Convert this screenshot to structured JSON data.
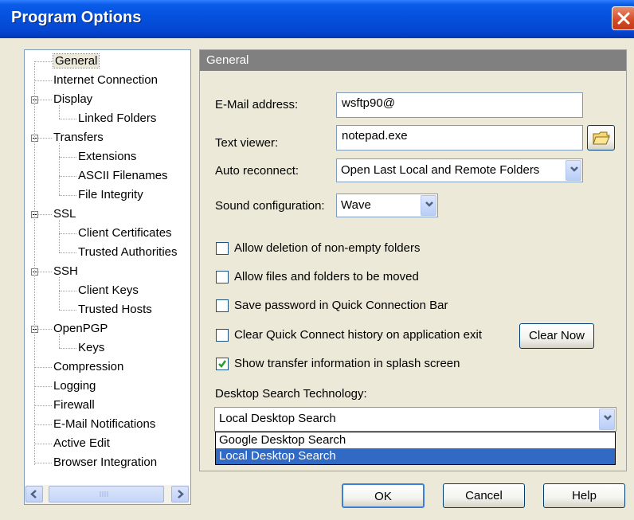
{
  "window": {
    "title": "Program Options"
  },
  "tree": {
    "items": [
      {
        "label": "General",
        "depth": 0,
        "expander": false,
        "selected": true
      },
      {
        "label": "Internet Connection",
        "depth": 0,
        "expander": false
      },
      {
        "label": "Display",
        "depth": 0,
        "expander": true
      },
      {
        "label": "Linked Folders",
        "depth": 1,
        "expander": false
      },
      {
        "label": "Transfers",
        "depth": 0,
        "expander": true
      },
      {
        "label": "Extensions",
        "depth": 1,
        "expander": false
      },
      {
        "label": "ASCII Filenames",
        "depth": 1,
        "expander": false
      },
      {
        "label": "File Integrity",
        "depth": 1,
        "expander": false
      },
      {
        "label": "SSL",
        "depth": 0,
        "expander": true
      },
      {
        "label": "Client Certificates",
        "depth": 1,
        "expander": false
      },
      {
        "label": "Trusted Authorities",
        "depth": 1,
        "expander": false
      },
      {
        "label": "SSH",
        "depth": 0,
        "expander": true
      },
      {
        "label": "Client Keys",
        "depth": 1,
        "expander": false
      },
      {
        "label": "Trusted Hosts",
        "depth": 1,
        "expander": false
      },
      {
        "label": "OpenPGP",
        "depth": 0,
        "expander": true
      },
      {
        "label": "Keys",
        "depth": 1,
        "expander": false
      },
      {
        "label": "Compression",
        "depth": 0,
        "expander": false
      },
      {
        "label": "Logging",
        "depth": 0,
        "expander": false
      },
      {
        "label": "Firewall",
        "depth": 0,
        "expander": false
      },
      {
        "label": "E-Mail Notifications",
        "depth": 0,
        "expander": false
      },
      {
        "label": "Active Edit",
        "depth": 0,
        "expander": false
      },
      {
        "label": "Browser Integration",
        "depth": 0,
        "expander": false
      }
    ]
  },
  "panel": {
    "header": "General",
    "email": {
      "label": "E-Mail address:",
      "value": "wsftp90@"
    },
    "viewer": {
      "label": "Text viewer:",
      "value": "notepad.exe"
    },
    "reconnect": {
      "label": "Auto reconnect:",
      "value": "Open Last Local and Remote Folders"
    },
    "sound": {
      "label": "Sound configuration:",
      "value": "Wave"
    },
    "checks": {
      "allow_delete": {
        "label": "Allow deletion of non-empty folders",
        "checked": false
      },
      "allow_move": {
        "label": "Allow files and folders to be moved",
        "checked": false
      },
      "save_password": {
        "label": "Save password in Quick Connection Bar",
        "checked": false
      },
      "clear_history": {
        "label": "Clear Quick Connect history on application exit",
        "checked": false
      },
      "show_transfer": {
        "label": "Show transfer information in splash screen",
        "checked": true
      }
    },
    "clear_now": "Clear Now",
    "desktop_search": {
      "label": "Desktop Search Technology:",
      "value": "Local Desktop Search",
      "options": [
        "Google Desktop Search",
        "Local Desktop Search"
      ],
      "highlighted": "Local Desktop Search"
    }
  },
  "buttons": {
    "ok": "OK",
    "cancel": "Cancel",
    "help": "Help"
  }
}
